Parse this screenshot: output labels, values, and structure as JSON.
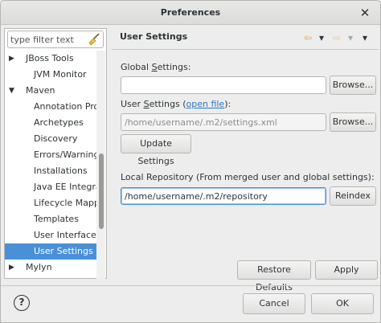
{
  "window": {
    "title": "Preferences",
    "close_glyph": "✕"
  },
  "filter": {
    "placeholder": "type filter text",
    "icon": "broom-icon"
  },
  "tree": {
    "items": [
      {
        "label": "JBoss Tools",
        "level": 0,
        "arrow": "▶"
      },
      {
        "label": "JVM Monitor",
        "level": 1,
        "arrow": ""
      },
      {
        "label": "Maven",
        "level": 0,
        "arrow": "▼"
      },
      {
        "label": "Annotation Proc",
        "level": 1,
        "arrow": ""
      },
      {
        "label": "Archetypes",
        "level": 1,
        "arrow": ""
      },
      {
        "label": "Discovery",
        "level": 1,
        "arrow": ""
      },
      {
        "label": "Errors/Warnings",
        "level": 1,
        "arrow": ""
      },
      {
        "label": "Installations",
        "level": 1,
        "arrow": ""
      },
      {
        "label": "Java EE Integrat",
        "level": 1,
        "arrow": ""
      },
      {
        "label": "Lifecycle Mappir",
        "level": 1,
        "arrow": ""
      },
      {
        "label": "Templates",
        "level": 1,
        "arrow": ""
      },
      {
        "label": "User Interface",
        "level": 1,
        "arrow": ""
      },
      {
        "label": "User Settings",
        "level": 1,
        "arrow": "",
        "selected": true
      },
      {
        "label": "Mylyn",
        "level": 0,
        "arrow": "▶"
      }
    ]
  },
  "page": {
    "title": "User Settings",
    "nav": {
      "back": "⇦",
      "back_menu": "▾",
      "forward": "⇨",
      "forward_menu": "▾",
      "view_menu": "▾"
    },
    "global": {
      "label_pre": "Global ",
      "label_u": "S",
      "label_post": "ettings:",
      "value": "",
      "browse": "Browse..."
    },
    "user": {
      "label_pre": "User ",
      "label_u": "S",
      "label_post": "ettings (",
      "link": "open file",
      "label_end": "):",
      "value": "/home/username/.m2/settings.xml",
      "browse": "Browse...",
      "update": "Update Settings"
    },
    "local": {
      "label": "Local Repository (From merged user and global settings):",
      "value": "/home/username/.m2/repository",
      "reindex": "Reindex"
    },
    "restore": "Restore Defaults",
    "apply": "Apply"
  },
  "footer": {
    "help": "?",
    "cancel": "Cancel",
    "ok": "OK"
  },
  "colors": {
    "selection": "#4a90d9",
    "link": "#2a76c6",
    "nav_arrow": "#e8a33d"
  }
}
